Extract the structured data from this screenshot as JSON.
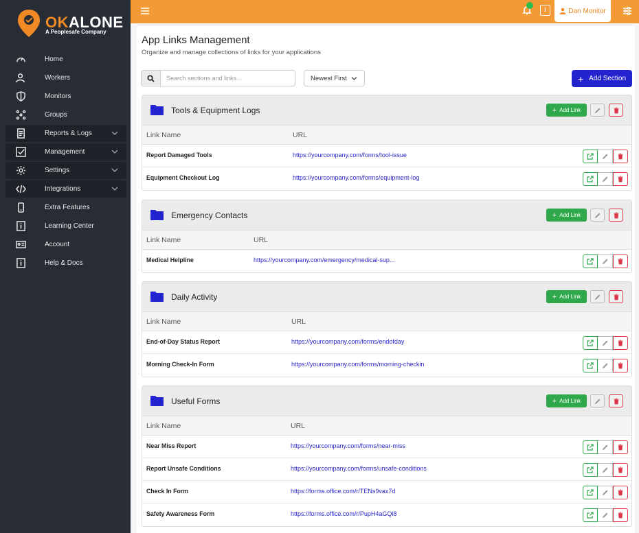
{
  "brand": {
    "name_part1": "OK",
    "name_part2": "ALONE",
    "tagline": "A Peoplesafe Company",
    "accent": "#f08a24"
  },
  "sidebar": {
    "items": [
      {
        "label": "Home",
        "icon": "gauge-icon"
      },
      {
        "label": "Workers",
        "icon": "users-icon"
      },
      {
        "label": "Monitors",
        "icon": "shield-icon"
      },
      {
        "label": "Groups",
        "icon": "groups-icon"
      },
      {
        "label": "Reports & Logs",
        "icon": "report-icon"
      },
      {
        "label": "Management",
        "icon": "checklist-icon"
      },
      {
        "label": "Settings",
        "icon": "gear-icon"
      },
      {
        "label": "Integrations",
        "icon": "code-icon"
      },
      {
        "label": "Extra Features",
        "icon": "phone-icon"
      },
      {
        "label": "Learning Center",
        "icon": "info-icon"
      },
      {
        "label": "Account",
        "icon": "id-card-icon"
      },
      {
        "label": "Help & Docs",
        "icon": "info-icon"
      }
    ]
  },
  "topbar": {
    "user_label": "Dan Monitor",
    "info_glyph": "i"
  },
  "page": {
    "title": "App Links Management",
    "subtitle": "Organize and manage collections of links for your applications",
    "search_placeholder": "Search sections and links...",
    "sort_label": "Newest First",
    "add_section_label": "Add Section",
    "add_link_label": "Add Link",
    "col_name": "Link Name",
    "col_url": "URL"
  },
  "sections": [
    {
      "title": "Tools & Equipment Logs",
      "links": [
        {
          "name": "Report Damaged Tools",
          "url": "https://yourcompany.com/forms/tool-issue"
        },
        {
          "name": "Equipment Checkout Log",
          "url": "https://yourcompany.com/forms/equipment-log"
        }
      ]
    },
    {
      "title": "Emergency Contacts",
      "links": [
        {
          "name": "Medical Helpline",
          "url": "https://yourcompany.com/emergency/medical-sup..."
        }
      ]
    },
    {
      "title": "Daily Activity",
      "links": [
        {
          "name": "End-of-Day Status Report",
          "url": "https://yourcompany.com/forms/endofday"
        },
        {
          "name": "Morning Check-In Form",
          "url": "https://yourcompany.com/forms/morning-checkin"
        }
      ]
    },
    {
      "title": "Useful Forms",
      "links": [
        {
          "name": "Near Miss Report",
          "url": "https://yourcompany.com/forms/near-miss"
        },
        {
          "name": "Report Unsafe Conditions",
          "url": "https://yourcompany.com/forms/unsafe-conditions"
        },
        {
          "name": "Check In Form",
          "url": "https://forms.office.com/r/TENs9vax7d"
        },
        {
          "name": "Safety Awareness Form",
          "url": "https://forms.office.com/r/PupH4aGQi8"
        }
      ]
    }
  ]
}
